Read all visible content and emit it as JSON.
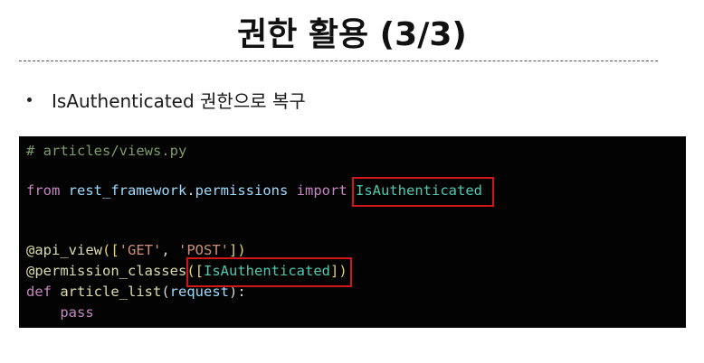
{
  "title": "권한 활용 (3/3)",
  "bullet": "IsAuthenticated 권한으로 복구",
  "code": {
    "line1": "# articles/views.py",
    "line2": {
      "kw_from": "from",
      "module": "rest_framework",
      "dot": ".",
      "submodule": "permissions",
      "kw_import": "import",
      "cls": "IsAuthenticated"
    },
    "line3": {
      "decorator": "@api_view",
      "open": "([",
      "s1": "'GET'",
      "comma": ", ",
      "s2": "'POST'",
      "close": "])"
    },
    "line4": {
      "decorator": "@permission_classes",
      "open_paren": "(",
      "open_bracket": "[",
      "cls": "IsAuthenticated",
      "close_bracket": "]",
      "close_paren": ")"
    },
    "line5": {
      "kw_def": "def",
      "fname": "article_list",
      "open": "(",
      "param": "request",
      "close": "):"
    },
    "line6": {
      "indent": "    ",
      "kw_pass": "pass"
    }
  },
  "colors": {
    "highlight_border": "#d1161a",
    "code_background": "#030303"
  }
}
